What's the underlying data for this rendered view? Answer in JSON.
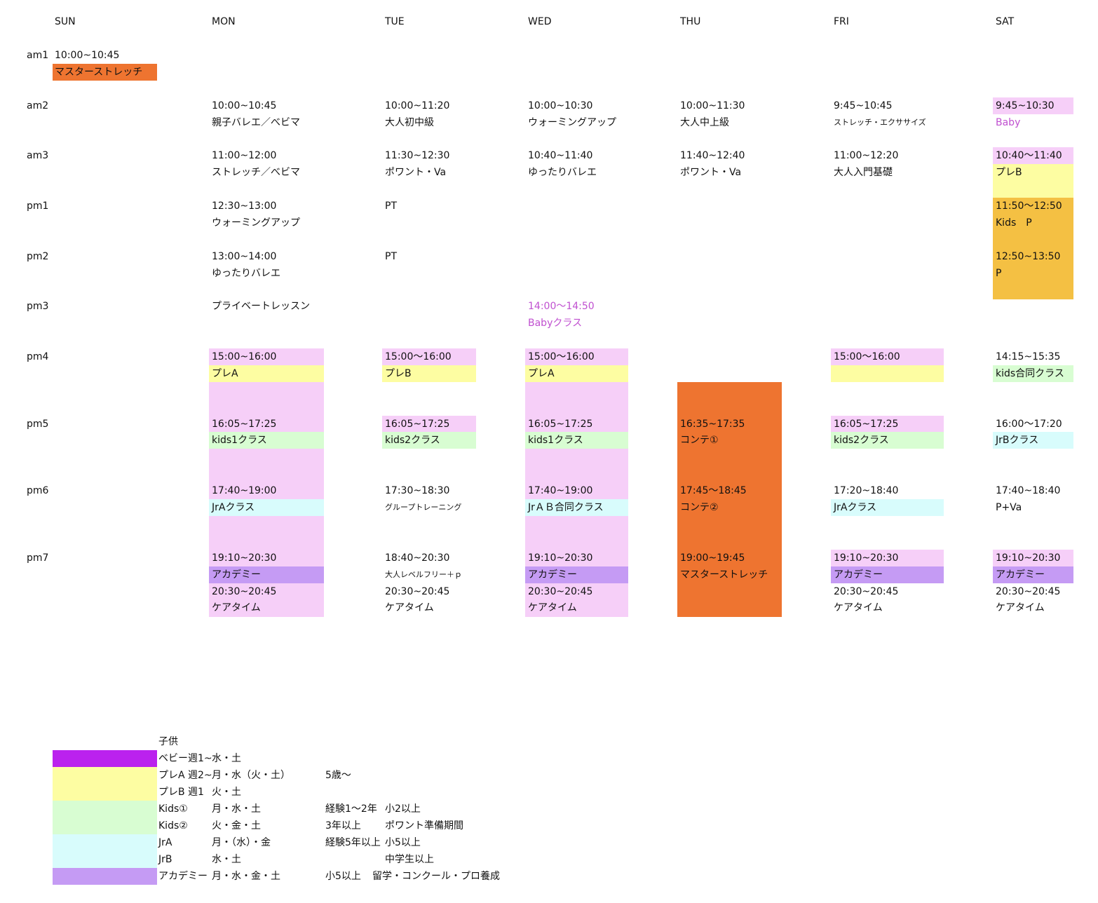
{
  "colors": {
    "orange": "#ee7430",
    "pink": "#f6cff8",
    "yellow": "#fdfda2",
    "green": "#d8fdd2",
    "cyan": "#d8fcfc",
    "purple": "#c59bf4",
    "gold": "#f4c043",
    "magenta": "#bb22ee",
    "baby_text": "#c050d0"
  },
  "days": [
    "SUN",
    "MON",
    "TUE",
    "WED",
    "THU",
    "FRI",
    "SAT"
  ],
  "slots": [
    "am1",
    "am2",
    "am3",
    "pm1",
    "pm2",
    "pm3",
    "pm4",
    "pm5",
    "pm6",
    "pm7"
  ],
  "sun": {
    "am1_time": "10:00~10:45",
    "am1_class": "マスターストレッチ"
  },
  "mon": {
    "am2_time": "10:00~10:45",
    "am2_class": "親子バレエ／べビマ",
    "am3_time": "11:00~12:00",
    "am3_class": "ストレッチ／べビマ",
    "pm1_time": "12:30~13:00",
    "pm1_class": "ウォーミングアップ",
    "pm2_time": "13:00~14:00",
    "pm2_class": "ゆったりバレエ",
    "pm3_class": "プライベートレッスン",
    "pm4_time": "15:00~16:00",
    "pm4_class": "プレA",
    "pm5_time": "16:05~17:25",
    "pm5_class": "kids1クラス",
    "pm6_time": "17:40~19:00",
    "pm6_class": "JrAクラス",
    "pm7_time": "19:10~20:30",
    "pm7_class": "アカデミー",
    "pm7b_time": "20:30~20:45",
    "pm7b_class": "ケアタイム"
  },
  "tue": {
    "am2_time": "10:00~11:20",
    "am2_class": "大人初中級",
    "am3_time": "11:30~12:30",
    "am3_class": "ポワント・Va",
    "pm1_class": "PT",
    "pm2_class": "PT",
    "pm4_time": "15:00〜16:00",
    "pm4_class": "プレB",
    "pm5_time": "16:05~17:25",
    "pm5_class": "kids2クラス",
    "pm6_time": "17:30~18:30",
    "pm6_class": "グループトレーニング",
    "pm7_time": "18:40~20:30",
    "pm7_class": "大人レベルフリー＋ｐ",
    "pm7b_time": "20:30~20:45",
    "pm7b_class": "ケアタイム"
  },
  "wed": {
    "am2_time": "10:00~10:30",
    "am2_class": "ウォーミングアップ",
    "am3_time": "10:40~11:40",
    "am3_class": "ゆったりバレエ",
    "pm3_time": "14:00〜14:50",
    "pm3_class": "Babyクラス",
    "pm4_time": "15:00〜16:00",
    "pm4_class": "プレA",
    "pm5_time": "16:05~17:25",
    "pm5_class": "kids1クラス",
    "pm6_time": "17:40~19:00",
    "pm6_class": "JrＡＢ合同クラス",
    "pm7_time": "19:10~20:30",
    "pm7_class": "アカデミー",
    "pm7b_time": "20:30~20:45",
    "pm7b_class": "ケアタイム"
  },
  "thu": {
    "am2_time": "10:00~11:30",
    "am2_class": "大人中上級",
    "am3_time": "11:40~12:40",
    "am3_class": "ポワント・Va",
    "pm5_time": "16:35~17:35",
    "pm5_class": "コンテ①",
    "pm6_time": "17:45〜18:45",
    "pm6_class": "コンテ②",
    "pm7_time": "19:00~19:45",
    "pm7_class": "マスターストレッチ"
  },
  "fri": {
    "am2_time": "9:45~10:45",
    "am2_class": "ストレッチ・エクササイズ",
    "am3_time": "11:00~12:20",
    "am3_class": "大人入門基礎",
    "pm4_time": "15:00〜16:00",
    "pm5_time": "16:05~17:25",
    "pm5_class": "kids2クラス",
    "pm6_time": "17:20~18:40",
    "pm6_class": "JrAクラス",
    "pm7_time": "19:10~20:30",
    "pm7_class": "アカデミー",
    "pm7b_time": "20:30~20:45",
    "pm7b_class": "ケアタイム"
  },
  "sat": {
    "am2_time": "9:45~10:30",
    "am2_class": "Baby",
    "am3_time": "10:40〜11:40",
    "am3_class": "プレB",
    "pm1_time": "11:50〜12:50",
    "pm1_class": "Kids　P",
    "pm2_time": "12:50~13:50",
    "pm2_class": "P",
    "pm4_time": "14:15~15:35",
    "pm4_class": "kids合同クラス",
    "pm5_time": "16:00〜17:20",
    "pm5_class": "JrBクラス",
    "pm6_time": "17:40~18:40",
    "pm6_class": "P+Va",
    "pm7_time": "19:10~20:30",
    "pm7_class": "アカデミー",
    "pm7b_time": "20:30~20:45",
    "pm7b_class": "ケアタイム"
  },
  "legend": {
    "title": "子供",
    "rows": [
      {
        "name": "ベビー週1~",
        "days": "水・土",
        "cond": "",
        "note": ""
      },
      {
        "name": "プレA 週2~",
        "days": "月・水（火・土）",
        "cond": "5歳〜",
        "note": ""
      },
      {
        "name": "プレB 週1",
        "days": "火・土",
        "cond": "",
        "note": ""
      },
      {
        "name": "Kids①",
        "days": "月・水・土",
        "cond": "経験1〜2年",
        "note": "小2以上"
      },
      {
        "name": "Kids②",
        "days": "火・金・土",
        "cond": "3年以上",
        "note": "ポワント準備期間"
      },
      {
        "name": "JrA",
        "days": "月・（水）・金",
        "cond": "経験5年以上",
        "note": "小5以上"
      },
      {
        "name": "JrB",
        "days": "水・土",
        "cond": "",
        "note": "中学生以上"
      },
      {
        "name": "アカデミー",
        "days": "月・水・金・土",
        "cond": "小5以上",
        "note": "留学・コンクール・プロ養成"
      }
    ]
  }
}
